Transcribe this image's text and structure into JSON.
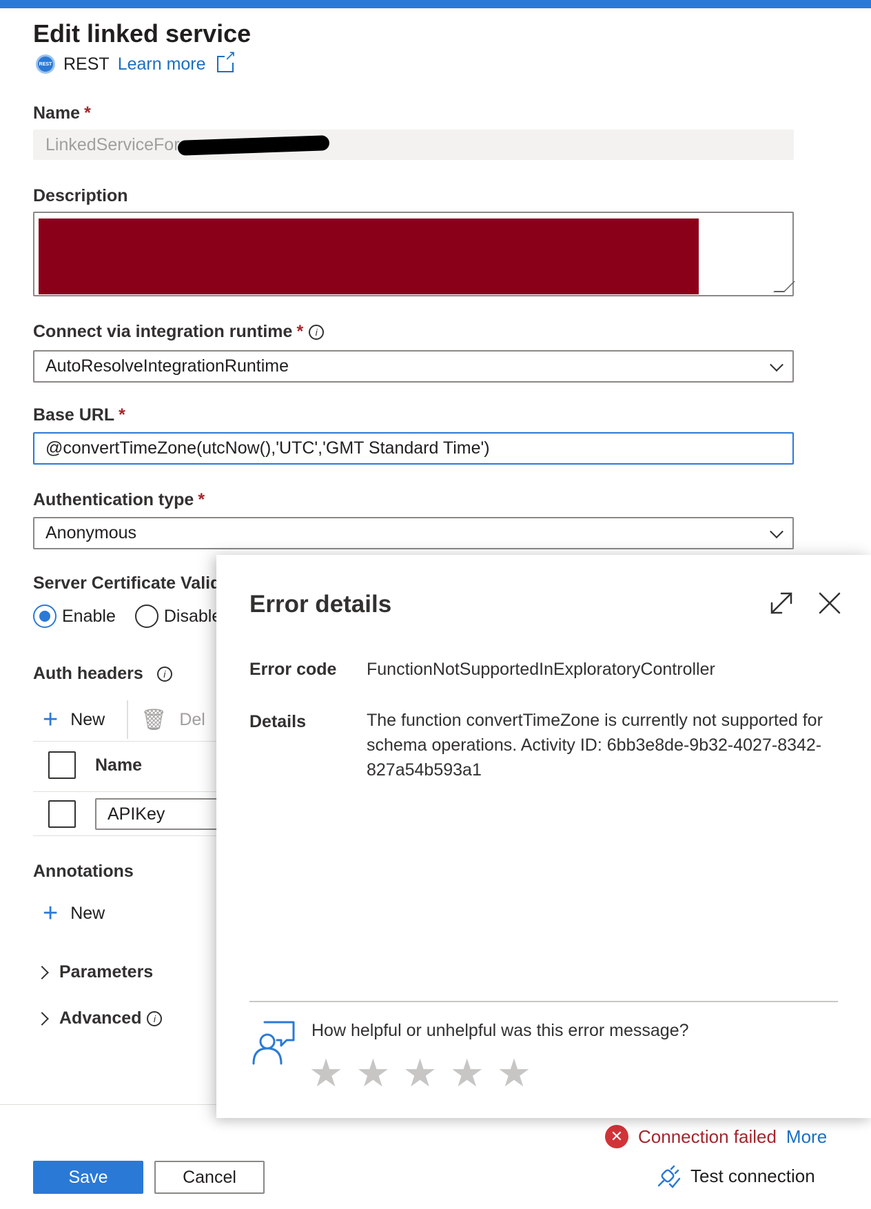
{
  "header": {
    "title": "Edit linked service",
    "service_type": "REST",
    "rest_icon_text": "REST",
    "learn_more": "Learn more"
  },
  "form": {
    "name_label": "Name",
    "name_value": "LinkedServiceFor",
    "required_mark": "*",
    "description_label": "Description",
    "runtime_label": "Connect via integration runtime",
    "runtime_value": "AutoResolveIntegrationRuntime",
    "base_url_label": "Base URL",
    "base_url_value": "@convertTimeZone(utcNow(),'UTC','GMT Standard Time')",
    "auth_type_label": "Authentication type",
    "auth_type_value": "Anonymous",
    "cert_label": "Server Certificate Valid",
    "cert_options": [
      "Enable",
      "Disable"
    ],
    "cert_selected": "Enable",
    "auth_headers_label": "Auth headers",
    "new_label": "New",
    "delete_label": "Del",
    "headers_table_header": "Name",
    "headers_rows": [
      "APIKey"
    ],
    "annotations_label": "Annotations",
    "annotations_new": "New",
    "parameters_label": "Parameters",
    "advanced_label": "Advanced"
  },
  "footer": {
    "save": "Save",
    "cancel": "Cancel",
    "status": "Connection failed",
    "more": "More",
    "test_connection": "Test connection"
  },
  "error_panel": {
    "title": "Error details",
    "code_label": "Error code",
    "code_value": "FunctionNotSupportedInExploratoryController",
    "details_label": "Details",
    "details_value": "The function convertTimeZone is currently not supported for schema operations. Activity ID: 6bb3e8de-9b32-4027-8342-827a54b593a1",
    "feedback_question": "How helpful or unhelpful was this error message?",
    "stars": 5
  },
  "colors": {
    "accent": "#2b79d6",
    "error": "#a4262c",
    "redaction": "#8b0019"
  }
}
